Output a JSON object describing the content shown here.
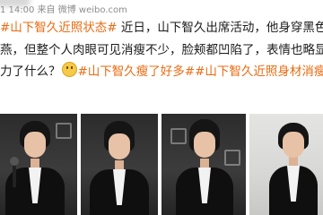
{
  "post": {
    "meta_line": "1 14:00 来自 微博 weibo.com",
    "lines": [
      {
        "tag": "#山下智久近照状态#",
        "text": " 近日，山下智久出席活动，他身穿黑色西服搭配"
      },
      {
        "text": "燕，但整个人肉眼可见消瘦不少，脸颊都凹陷了，表情也略显疲惫"
      },
      {
        "text": "力了什么？",
        "tag": "#山下智久瘦了好多#",
        "tag2": "#山下智久近照身材消瘦#"
      }
    ]
  },
  "photos": [
    {
      "name": "photo-1",
      "theme": "dark"
    },
    {
      "name": "photo-2",
      "theme": "dark"
    },
    {
      "name": "photo-3",
      "theme": "dark"
    },
    {
      "name": "photo-4",
      "theme": "light"
    }
  ],
  "colors": {
    "topic_tag": "#e86b11",
    "meta_text": "#8c8c8c",
    "body_text": "#1a1a1a"
  },
  "icons": {
    "emoji": "thinking-face-emoji"
  }
}
